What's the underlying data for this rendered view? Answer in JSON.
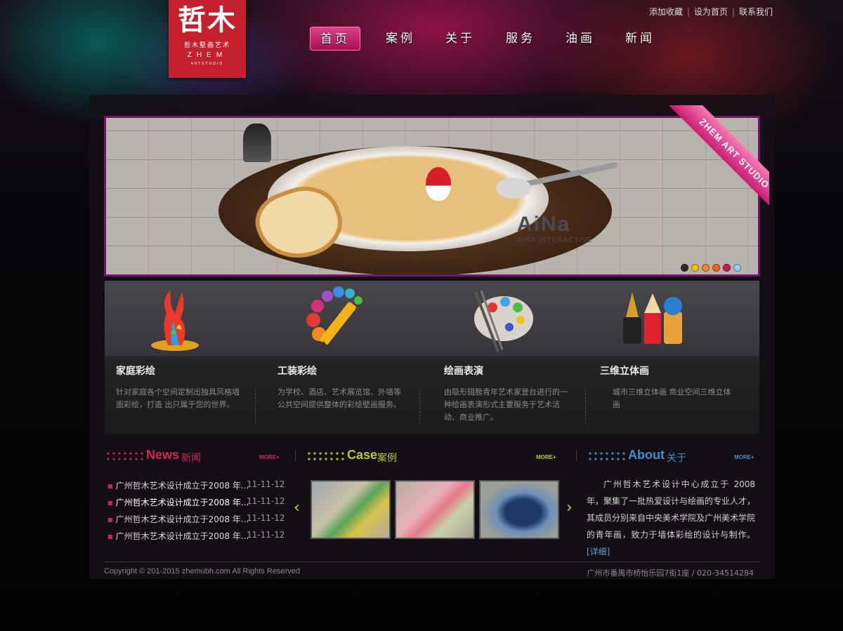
{
  "logo": {
    "big": "哲木",
    "cn": "哲木墅画艺术",
    "en": "ZHEM",
    "en2": "ARTSTUDIO"
  },
  "toplinks": [
    "添加收藏",
    "设为首页",
    "联系我们"
  ],
  "nav": [
    "首页",
    "案例",
    "关于",
    "服务",
    "油画",
    "新闻"
  ],
  "nav_active": 0,
  "banner": {
    "ribbon": "ZHEM ART STUDIO",
    "brand_logo": "AiNa",
    "brand_sub": "AINA INTERACTIVE",
    "dots": [
      "#2c2c2c",
      "#f2c118",
      "#ef8a25",
      "#e6661e",
      "#c8195a",
      "#8ed3ef"
    ]
  },
  "services": [
    {
      "title": "家庭彩绘",
      "text": "针对家庭各个空间定制出独具风格墙面彩绘，打造 出只属于您的世界。",
      "icon": "paint-splash-icon"
    },
    {
      "title": "工装彩绘",
      "text": "为学校、酒店、艺术展览馆、外墙等公共空间提供整体的彩绘壁画服务。",
      "icon": "pencil-color-wheel-icon"
    },
    {
      "title": "绘画表演",
      "text": "由隐形翅膀青年艺术家登台进行的一种绘画表演形式主要服务于艺术活动、商业推广。",
      "icon": "palette-icon"
    },
    {
      "title": "三维立体画",
      "text": "城市三维立体画 商业空间三维立体画",
      "icon": "pen-pencil-brush-icon"
    }
  ],
  "news": {
    "en": "News",
    "cn": "新闻",
    "more": "MORE+",
    "items": [
      {
        "title": "广州哲木艺术设计成立于2008 年...",
        "date": "11-11-12"
      },
      {
        "title": "广州哲木艺术设计成立于2008 年...",
        "date": "11-11-12"
      },
      {
        "title": "广州哲木艺术设计成立于2008 年...",
        "date": "11-11-12"
      },
      {
        "title": "广州哲木艺术设计成立于2008 年...",
        "date": "11-11-12"
      }
    ]
  },
  "case": {
    "en": "Case",
    "cn": "案例",
    "more": "MORE+"
  },
  "about": {
    "en": "About",
    "cn": "关于",
    "more": "MORE+",
    "text": "广州哲木艺术设计中心成立于 2008 年，聚集了一批热爱设计与绘画的专业人才，其成员分别来自中央美术学院及广州美术学院的青年画，致力于墙体彩绘的设计与制作。",
    "detail": "[详细]"
  },
  "colors": {
    "news": "#d4245d",
    "case": "#b8cc2f",
    "about": "#3f8fd1",
    "nav_active": "#d32a79"
  },
  "footer": {
    "copyright": "Copyright © 201-2015  zhemubh.com All Rights Reserved",
    "address": "广州市番禺市桥怡乐园7街1座 / 020-34514284"
  }
}
